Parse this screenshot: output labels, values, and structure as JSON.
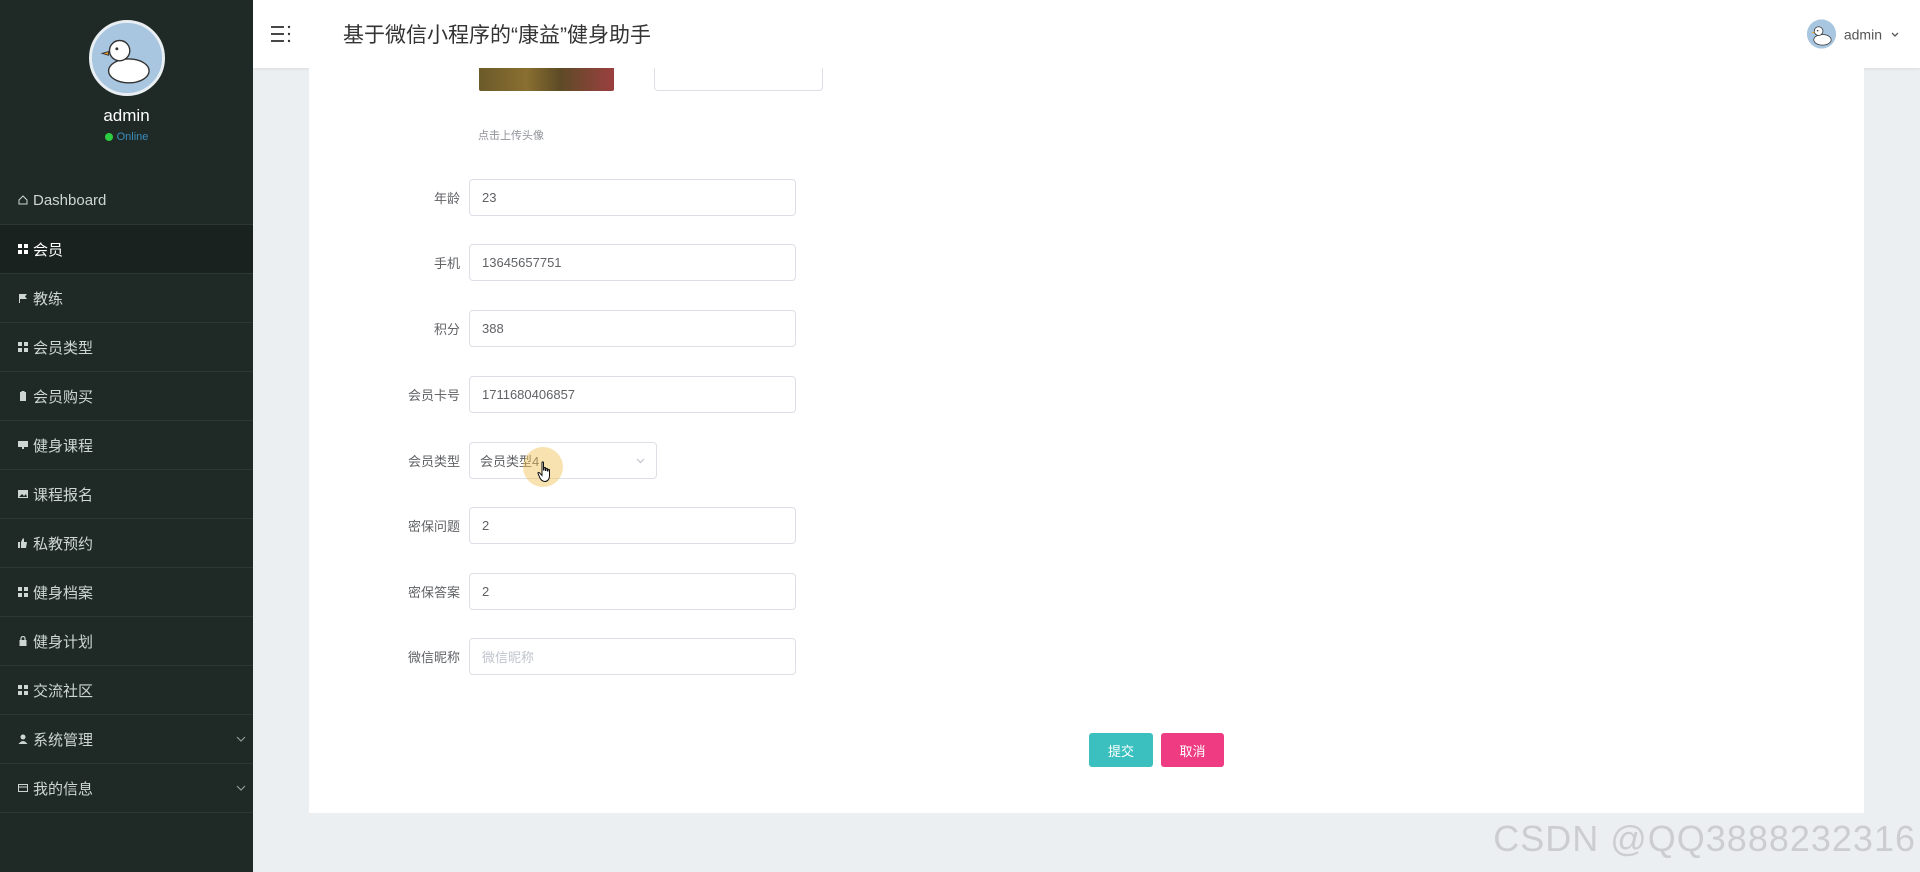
{
  "header": {
    "title": "基于微信小程序的“康益”健身助手",
    "user_name": "admin"
  },
  "sidebar": {
    "profile_name": "admin",
    "profile_status": "Online",
    "items": [
      {
        "label": "Dashboard",
        "icon": "home-icon"
      },
      {
        "label": "会员",
        "icon": "grid-icon",
        "active": true
      },
      {
        "label": "教练",
        "icon": "flag-icon"
      },
      {
        "label": "会员类型",
        "icon": "grid-icon"
      },
      {
        "label": "会员购买",
        "icon": "clipboard-icon"
      },
      {
        "label": "健身课程",
        "icon": "monitor-icon"
      },
      {
        "label": "课程报名",
        "icon": "image-icon"
      },
      {
        "label": "私教预约",
        "icon": "thumb-icon"
      },
      {
        "label": "健身档案",
        "icon": "grid-icon"
      },
      {
        "label": "健身计划",
        "icon": "lock-icon"
      },
      {
        "label": "交流社区",
        "icon": "grid-icon"
      },
      {
        "label": "系统管理",
        "icon": "user-icon",
        "has_children": true
      },
      {
        "label": "我的信息",
        "icon": "card-icon",
        "has_children": true
      }
    ]
  },
  "form": {
    "upload_hint": "点击上传头像",
    "age_label": "年龄",
    "age_value": "23",
    "phone_label": "手机",
    "phone_value": "13645657751",
    "points_label": "积分",
    "points_value": "388",
    "card_no_label": "会员卡号",
    "card_no_value": "1711680406857",
    "member_type_label": "会员类型",
    "member_type_value": "会员类型4",
    "security_question_label": "密保问题",
    "security_question_value": "2",
    "security_answer_label": "密保答案",
    "security_answer_value": "2",
    "wechat_nickname_label": "微信昵称",
    "wechat_nickname_placeholder": "微信昵称",
    "submit_label": "提交",
    "cancel_label": "取消"
  },
  "watermark": "CSDN @QQ3888232316",
  "colors": {
    "sidebar_bg": "#1f2a27",
    "submit": "#3cc0bf",
    "cancel": "#ee3b81",
    "online": "#2ecc40"
  }
}
